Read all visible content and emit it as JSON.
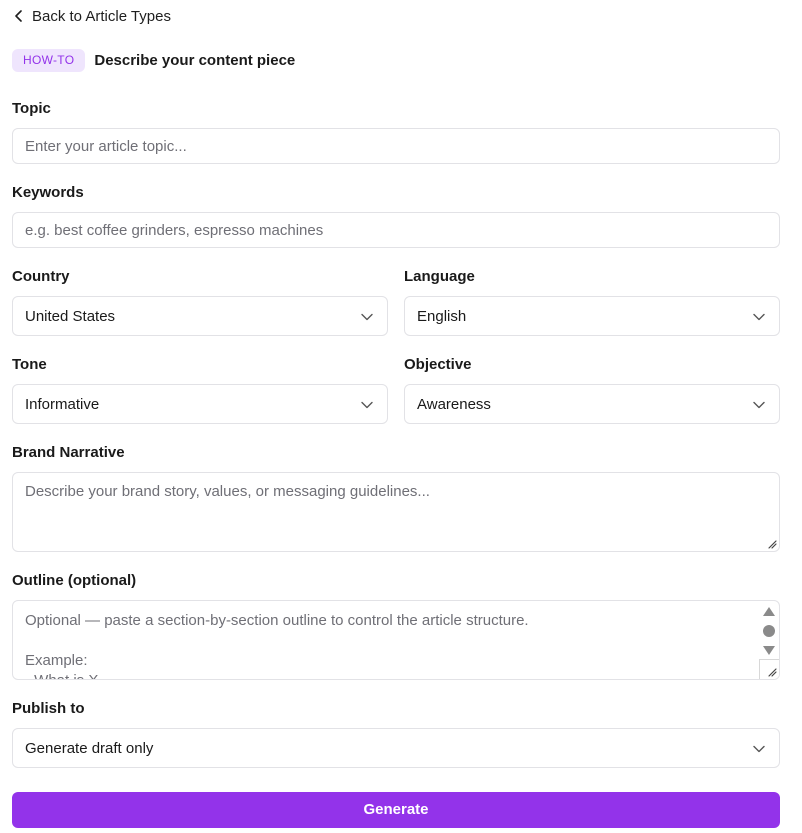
{
  "nav": {
    "back_label": "Back to Article Types"
  },
  "header": {
    "badge": "HOW-TO",
    "title": "Describe your content piece"
  },
  "topic": {
    "label": "Topic",
    "placeholder": "Enter your article topic..."
  },
  "keywords": {
    "label": "Keywords",
    "placeholder": "e.g. best coffee grinders, espresso machines"
  },
  "country": {
    "label": "Country",
    "value": "United States"
  },
  "language": {
    "label": "Language",
    "value": "English"
  },
  "tone": {
    "label": "Tone",
    "value": "Informative"
  },
  "objective": {
    "label": "Objective",
    "value": "Awareness"
  },
  "brand_narrative": {
    "label": "Brand Narrative",
    "placeholder": "Describe your brand story, values, or messaging guidelines..."
  },
  "outline": {
    "label": "Outline (optional)",
    "placeholder_line1": "Optional — paste a section-by-section outline to control the article structure.",
    "placeholder_line3": "Example:",
    "placeholder_line4": "- What is X"
  },
  "publish": {
    "label": "Publish to",
    "value": "Generate draft only"
  },
  "actions": {
    "generate_label": "Generate"
  },
  "colors": {
    "accent": "#9333ea",
    "badge_bg": "#efe5fd",
    "border": "#e2e2e6",
    "placeholder": "#6f6f76"
  },
  "icons": {
    "back": "chevron-left-icon",
    "dropdown": "chevron-down-icon"
  }
}
